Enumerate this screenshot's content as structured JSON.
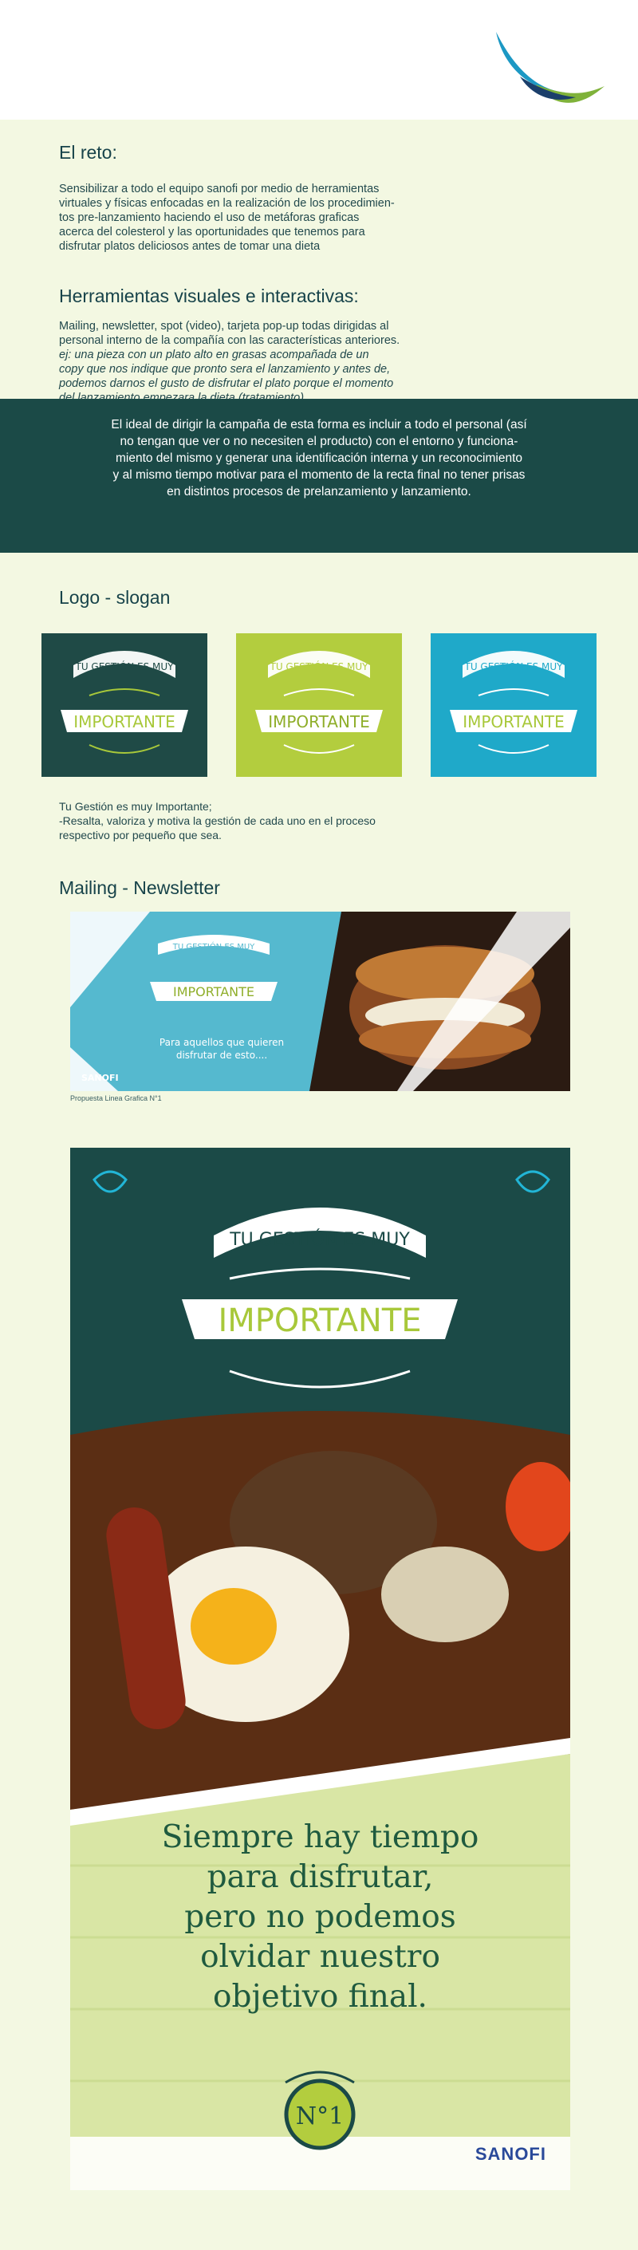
{
  "header": {
    "logo_icon": "bird-wing-icon"
  },
  "reto": {
    "title": "El reto:",
    "lines": [
      "Sensibilizar a todo el equipo sanofi por medio de herramientas",
      "virtuales y físicas enfocadas en la realización de los procedimien-",
      "tos pre-lanzamiento haciendo el uso de metáforas graficas",
      "acerca del colesterol y las oportunidades que tenemos para",
      "disfrutar platos deliciosos antes de tomar una dieta"
    ]
  },
  "herramientas": {
    "title": "Herramientas visuales e interactivas:",
    "lines": [
      "Mailing, newsletter, spot (video), tarjeta pop-up todas dirigidas al",
      "personal interno de la compañía con las características anteriores."
    ],
    "italic_lines": [
      "ej: una pieza con un plato alto en grasas acompañada de un",
      "copy que nos indique que pronto sera el lanzamiento y antes de,",
      "podemos darnos el gusto de disfrutar el plato porque el momento",
      "del lanzamiento empezara la dieta (tratamiento)."
    ]
  },
  "ideal": {
    "lines": [
      "El ideal de dirigir la campaña de esta forma es incluir a todo el personal (así",
      "no tengan que ver o no necesiten el producto) con el entorno y funciona-",
      "miento del mismo y generar una identificación interna y un reconocimiento",
      "y al mismo tiempo motivar para el momento de la recta final no tener prisas",
      "en distintos procesos de prelanzamiento y lanzamiento."
    ]
  },
  "logo": {
    "title": "Logo - slogan",
    "badge_top": "TU GESTIÓN ES MUY",
    "badge_main": "IMPORTANTE",
    "variants": [
      {
        "bg": "#1f4a46",
        "ink": "#a8c83a",
        "banner": "#ffffff"
      },
      {
        "bg": "#b3cd3e",
        "ink": "#ffffff",
        "banner": "#ffffff"
      },
      {
        "bg": "#1fa9c9",
        "ink": "#ffffff",
        "banner": "#ffffff"
      }
    ]
  },
  "caption": {
    "lines": [
      "Tu Gestión es muy Importante;",
      "-Resalta, valoriza y motiva la gestión de cada uno en el proceso",
      "respectivo por pequeño que sea."
    ]
  },
  "mailing": {
    "title": "Mailing - Newsletter",
    "tagline_1": "Para aquellos que quieren",
    "tagline_2": "disfrutar de esto....",
    "brand": "SANOFI",
    "caption": "Propuesta Linea Grafica N°1"
  },
  "poster": {
    "badge_top": "TU GESTIÓN ES MUY",
    "badge_main": "IMPORTANTE",
    "slogan": [
      "Siempre hay tiempo",
      "para disfrutar,",
      "pero no podemos",
      "olvidar nuestro",
      "objetivo final."
    ],
    "number": "N°1",
    "brand": "SANOFI"
  },
  "colors": {
    "page_bg": "#f3f8e2",
    "dark_teal": "#1b4a47",
    "lime": "#b3cd3e",
    "cyan": "#1fa9c9"
  }
}
